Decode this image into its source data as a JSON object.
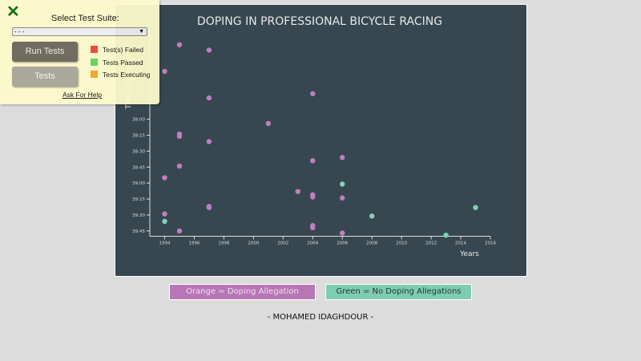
{
  "chart_data": {
    "type": "scatter",
    "title": "DOPING IN PROFESSIONAL BICYCLE RACING",
    "xlabel": "Years",
    "ylabel": "Time in Minutes",
    "xlim": [
      1993,
      2016
    ],
    "ylim": [
      "36:40",
      "39:50"
    ],
    "y_reversed": true,
    "xticks": [
      "1994",
      "1996",
      "1998",
      "2000",
      "2002",
      "2004",
      "2006",
      "2008",
      "2010",
      "2012",
      "2014",
      "2016"
    ],
    "yticks": [
      "38:00",
      "38:15",
      "38:30",
      "38:45",
      "39:00",
      "39:15",
      "39:30",
      "39:45"
    ],
    "colors": {
      "doping": "#c07fc0",
      "clean": "#7fd3b4"
    },
    "points": [
      {
        "year": 1995,
        "time": "36:50",
        "doping": true
      },
      {
        "year": 1997,
        "time": "36:55",
        "doping": true
      },
      {
        "year": 1994,
        "time": "37:15",
        "doping": true
      },
      {
        "year": 1997,
        "time": "37:40",
        "doping": true
      },
      {
        "year": 2004,
        "time": "37:36",
        "doping": true
      },
      {
        "year": 2001,
        "time": "38:04",
        "doping": true
      },
      {
        "year": 1995,
        "time": "38:14",
        "doping": true
      },
      {
        "year": 1995,
        "time": "38:16",
        "doping": true
      },
      {
        "year": 1997,
        "time": "38:21",
        "doping": true
      },
      {
        "year": 2004,
        "time": "38:39",
        "doping": true
      },
      {
        "year": 2006,
        "time": "38:36",
        "doping": true
      },
      {
        "year": 1995,
        "time": "38:44",
        "doping": true
      },
      {
        "year": 1994,
        "time": "38:55",
        "doping": true
      },
      {
        "year": 2006,
        "time": "39:01",
        "doping": false
      },
      {
        "year": 2003,
        "time": "39:08",
        "doping": true
      },
      {
        "year": 2004,
        "time": "39:11",
        "doping": true
      },
      {
        "year": 2004,
        "time": "39:13",
        "doping": true
      },
      {
        "year": 2006,
        "time": "39:14",
        "doping": true
      },
      {
        "year": 1997,
        "time": "39:22",
        "doping": true
      },
      {
        "year": 1997,
        "time": "39:23",
        "doping": true
      },
      {
        "year": 2015,
        "time": "39:23",
        "doping": false
      },
      {
        "year": 1994,
        "time": "39:29",
        "doping": true
      },
      {
        "year": 2008,
        "time": "39:31",
        "doping": false
      },
      {
        "year": 1994,
        "time": "39:36",
        "doping": false
      },
      {
        "year": 2004,
        "time": "39:40",
        "doping": true
      },
      {
        "year": 2004,
        "time": "39:42",
        "doping": true
      },
      {
        "year": 1995,
        "time": "39:45",
        "doping": true
      },
      {
        "year": 2006,
        "time": "39:47",
        "doping": true
      },
      {
        "year": 2013,
        "time": "39:49",
        "doping": false
      }
    ]
  },
  "legend": {
    "doping": "Orange = Doping Allegation",
    "clean": "Green = No Doping Allegations"
  },
  "author": "- MOHAMED IDAGHDOUR -",
  "test_panel": {
    "close_icon": "close-icon",
    "label": "Select Test Suite:",
    "select_value": "- - -",
    "run_label": "Run Tests",
    "tests_label": "Tests",
    "status": [
      {
        "label": "Test(s) Failed",
        "color": "#f44336"
      },
      {
        "label": "Tests Passed",
        "color": "#5cd65c"
      },
      {
        "label": "Tests Executing",
        "color": "#f5a623"
      }
    ],
    "help": "Ask For Help"
  }
}
